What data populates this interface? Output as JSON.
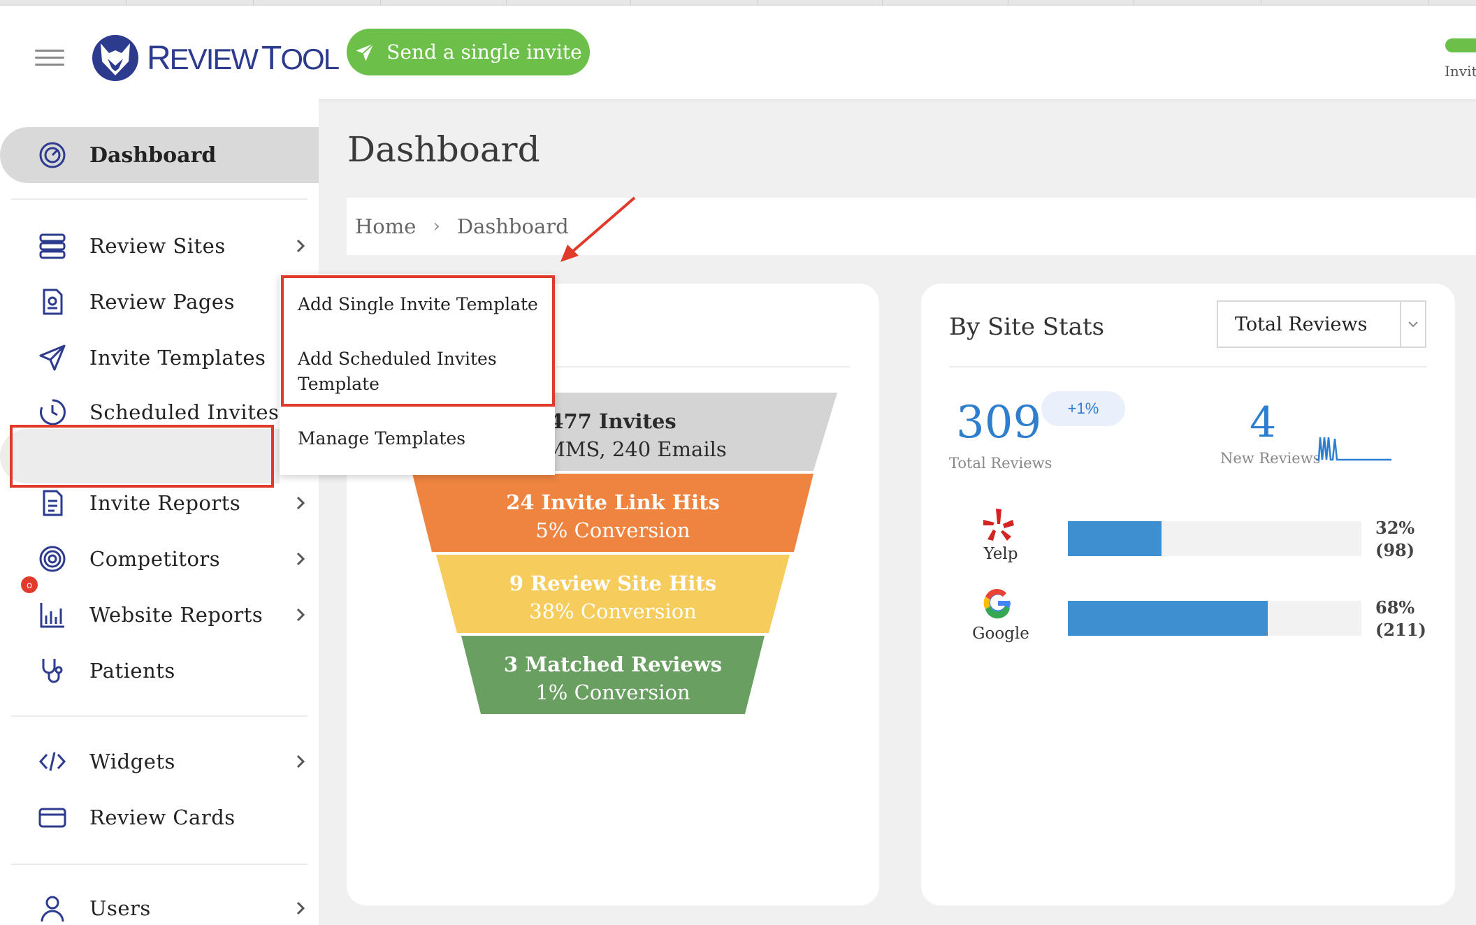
{
  "header": {
    "logo_text_a": "R",
    "logo_text_b": "EVIEW",
    "logo_text_c": "T",
    "logo_text_d": "OOL",
    "send_invite_label": "Send a single invite",
    "right_cutoff_label": "Invit"
  },
  "sidebar": {
    "dashboard": "Dashboard",
    "items": [
      {
        "label": "Review Sites",
        "icon": "server-icon",
        "chevron": true
      },
      {
        "label": "Review Pages",
        "icon": "document-icon",
        "chevron": false
      },
      {
        "label": "Invite Templates",
        "icon": "paper-plane-icon",
        "chevron": false
      },
      {
        "label": "Scheduled Invites",
        "icon": "clock-icon",
        "chevron": false
      },
      {
        "label": "Invite Reports",
        "icon": "report-icon",
        "chevron": true
      },
      {
        "label": "Competitors",
        "icon": "target-icon",
        "chevron": true
      },
      {
        "label": "Website Reports",
        "icon": "bar-chart-icon",
        "chevron": true
      },
      {
        "label": "Patients",
        "icon": "stethoscope-icon",
        "chevron": false
      },
      {
        "label": "Widgets",
        "icon": "code-icon",
        "chevron": true
      },
      {
        "label": "Review Cards",
        "icon": "card-icon",
        "chevron": false
      },
      {
        "label": "Users",
        "icon": "user-icon",
        "chevron": true
      }
    ],
    "invite_reports_badge": "o"
  },
  "main": {
    "title": "Dashboard",
    "breadcrumb": {
      "home": "Home",
      "current": "Dashboard"
    }
  },
  "dropdown": {
    "items": [
      "Add Single Invite Template",
      "Add Scheduled Invites",
      "Template",
      "Manage Templates"
    ]
  },
  "funnel": {
    "stages": [
      {
        "title": "477 Invites",
        "sub": "S, 4 MMS, 240 Emails",
        "color": "#d4d4d4"
      },
      {
        "title": "24 Invite Link Hits",
        "sub": "5% Conversion",
        "color": "#ee8440"
      },
      {
        "title": "9 Review Site Hits",
        "sub": "38% Conversion",
        "color": "#f6cd5c"
      },
      {
        "title": "3 Matched Reviews",
        "sub": "1% Conversion",
        "color": "#6a9f62"
      }
    ]
  },
  "site_stats": {
    "title": "By Site Stats",
    "select_value": "Total Reviews",
    "total_reviews": "309",
    "total_reviews_label": "Total Reviews",
    "change": "+1%",
    "new_reviews": "4",
    "new_reviews_label": "New Reviews",
    "sites": [
      {
        "name": "Yelp",
        "icon": "yelp-icon",
        "fraction": 0.32,
        "pct": "32%",
        "count": "(98)"
      },
      {
        "name": "Google",
        "icon": "google-icon",
        "fraction": 0.68,
        "pct": "68%",
        "count": "(211)"
      }
    ],
    "accent": "#2e7ed0"
  },
  "colors": {
    "highlight": "#e03a2a",
    "brand": "#2d3b8f",
    "send_button": "#6cc04a"
  }
}
